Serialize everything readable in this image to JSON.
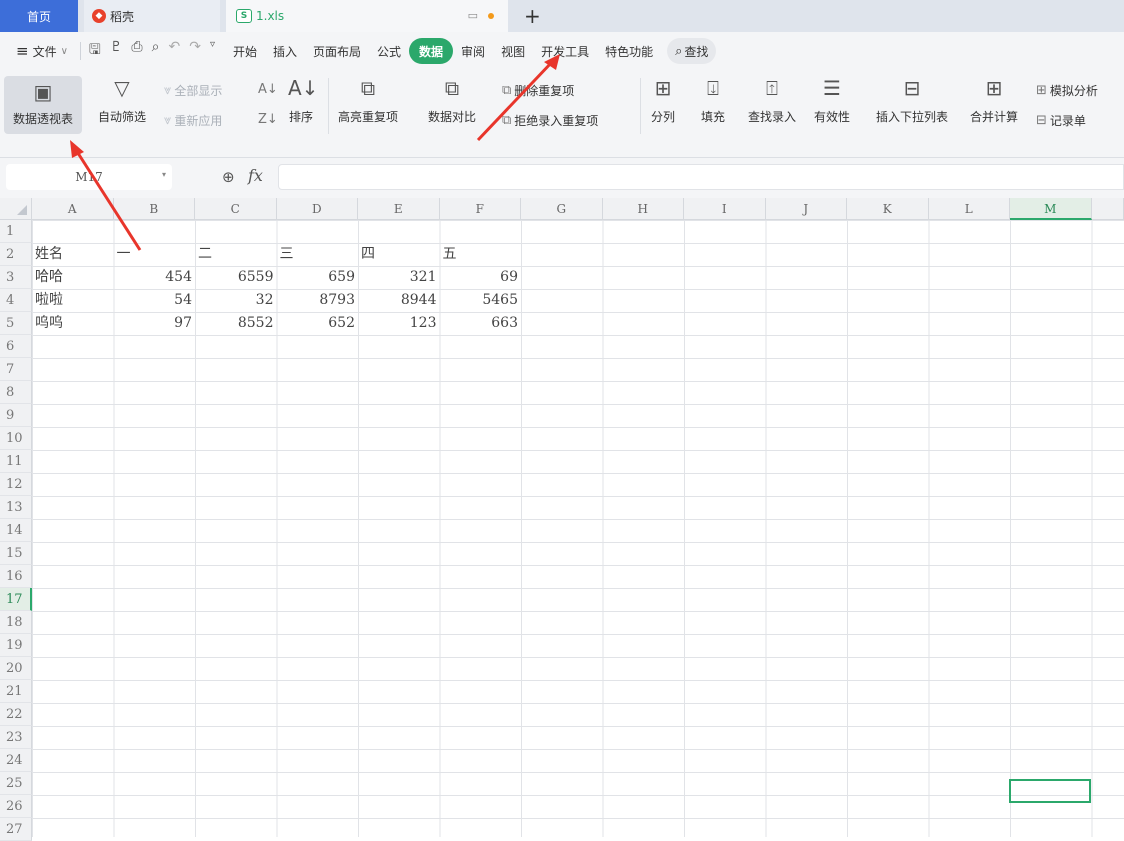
{
  "tabs": {
    "home": "首页",
    "daoke": "稻壳",
    "file": "1.xls",
    "new_tab": "+"
  },
  "menu": {
    "file": "文件",
    "items": [
      "开始",
      "插入",
      "页面布局",
      "公式",
      "数据",
      "审阅",
      "视图",
      "开发工具",
      "特色功能"
    ],
    "active": "数据",
    "search": "查找"
  },
  "ribbon": {
    "pivot": "数据透视表",
    "autofilter": "自动筛选",
    "show_all": "全部显示",
    "reapply": "重新应用",
    "sort": "排序",
    "highlight_dup": "高亮重复项",
    "compare": "数据对比",
    "delete_dup": "删除重复项",
    "reject_dup": "拒绝录入重复项",
    "split": "分列",
    "fill": "填充",
    "lookup": "查找录入",
    "validity": "有效性",
    "insert_dropdown": "插入下拉列表",
    "consolidate": "合并计算",
    "whatif": "模拟分析",
    "record": "记录单"
  },
  "formula_bar": {
    "name_box": "M17",
    "fx": "fx",
    "formula": ""
  },
  "columns": [
    "A",
    "B",
    "C",
    "D",
    "E",
    "F",
    "G",
    "H",
    "I",
    "J",
    "K",
    "L",
    "M"
  ],
  "selected_column": "M",
  "selected_row": "17",
  "rows": [
    "1",
    "2",
    "3",
    "4",
    "5",
    "6",
    "7",
    "8",
    "9",
    "10",
    "11",
    "12",
    "13",
    "14",
    "15",
    "16",
    "17",
    "18",
    "19",
    "20",
    "21",
    "22",
    "23",
    "24",
    "25",
    "26",
    "27"
  ],
  "sheet": {
    "header": [
      "姓名",
      "一",
      "二",
      "三",
      "四",
      "五"
    ],
    "data": [
      [
        "哈哈",
        "454",
        "6559",
        "659",
        "321",
        "69"
      ],
      [
        "啦啦",
        "54",
        "32",
        "8793",
        "8944",
        "5465"
      ],
      [
        "呜呜",
        "97",
        "8552",
        "652",
        "123",
        "663"
      ]
    ]
  },
  "colors": {
    "accent": "#2ba86b",
    "home_tab": "#3d6ed9",
    "arrow": "#e8352b"
  }
}
